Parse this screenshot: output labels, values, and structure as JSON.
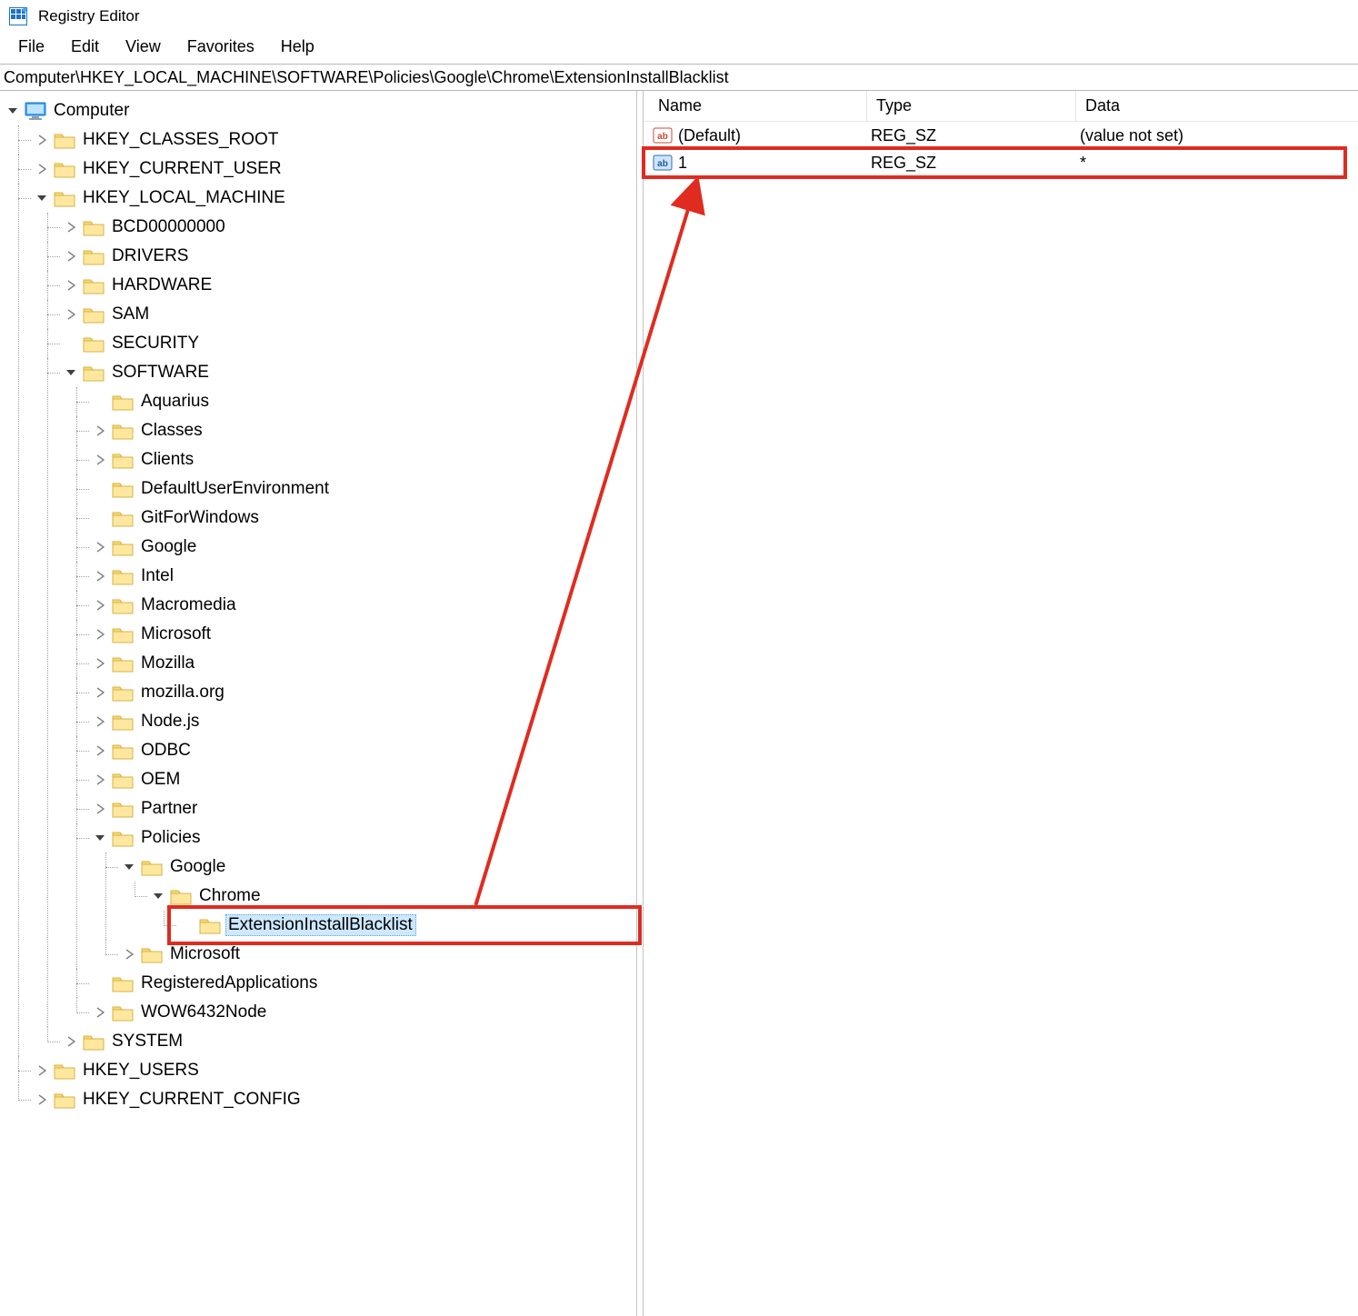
{
  "app": {
    "title": "Registry Editor"
  },
  "menu": {
    "file": "File",
    "edit": "Edit",
    "view": "View",
    "favorites": "Favorites",
    "help": "Help"
  },
  "path": "Computer\\HKEY_LOCAL_MACHINE\\SOFTWARE\\Policies\\Google\\Chrome\\ExtensionInstallBlacklist",
  "tree": {
    "root": "Computer",
    "hives": {
      "hkcr": "HKEY_CLASSES_ROOT",
      "hkcu": "HKEY_CURRENT_USER",
      "hklm": "HKEY_LOCAL_MACHINE",
      "hku": "HKEY_USERS",
      "hkcc": "HKEY_CURRENT_CONFIG"
    },
    "hklm_children": {
      "bcd": "BCD00000000",
      "drivers": "DRIVERS",
      "hardware": "HARDWARE",
      "sam": "SAM",
      "security": "SECURITY",
      "software": "SOFTWARE",
      "system": "SYSTEM"
    },
    "software_children": {
      "aquarius": "Aquarius",
      "classes": "Classes",
      "clients": "Clients",
      "due": "DefaultUserEnvironment",
      "gfw": "GitForWindows",
      "google": "Google",
      "intel": "Intel",
      "macromedia": "Macromedia",
      "microsoft": "Microsoft",
      "mozilla": "Mozilla",
      "mozillaorg": "mozilla.org",
      "nodejs": "Node.js",
      "odbc": "ODBC",
      "oem": "OEM",
      "partner": "Partner",
      "policies": "Policies",
      "regapps": "RegisteredApplications",
      "wow6432": "WOW6432Node"
    },
    "policies_children": {
      "google": "Google",
      "microsoft": "Microsoft"
    },
    "pol_google_children": {
      "chrome": "Chrome"
    },
    "chrome_children": {
      "eib": "ExtensionInstallBlacklist"
    }
  },
  "values": {
    "headers": {
      "name": "Name",
      "type": "Type",
      "data": "Data"
    },
    "rows": [
      {
        "name": "(Default)",
        "type": "REG_SZ",
        "data": "(value not set)",
        "selected": false
      },
      {
        "name": "1",
        "type": "REG_SZ",
        "data": "*",
        "selected": true
      }
    ]
  }
}
